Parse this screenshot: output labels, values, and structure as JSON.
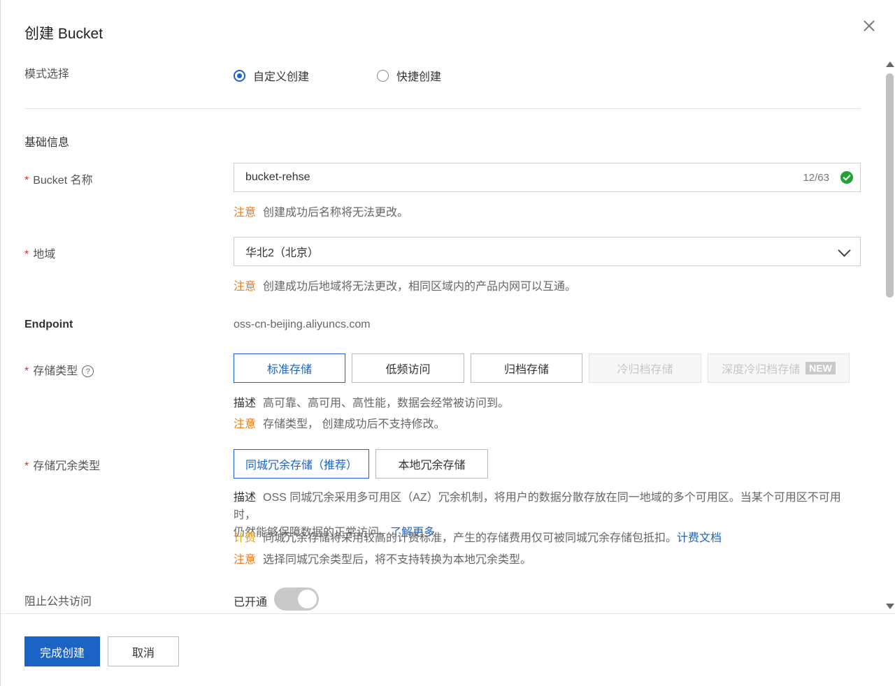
{
  "dialog": {
    "title": "创建 Bucket",
    "colors": {
      "accent": "#1b64c6",
      "warning": "#f07a14",
      "billing": "#e6a817",
      "required": "#d93026",
      "success": "#23a036"
    }
  },
  "mode": {
    "label": "模式选择",
    "options": [
      "自定义创建",
      "快捷创建"
    ],
    "selected": "自定义创建"
  },
  "basic_section": {
    "label": "基础信息"
  },
  "bucket_name": {
    "required_mark": "*",
    "label": "Bucket 名称",
    "value": "bucket-rehse",
    "counter": "12/63",
    "note_key": "注意",
    "note": "创建成功后名称将无法更改。"
  },
  "region": {
    "required_mark": "*",
    "label": "地域",
    "value": "华北2（北京）",
    "note_key": "注意",
    "note": "创建成功后地域将无法更改，相同区域内的产品内网可以互通。"
  },
  "endpoint": {
    "label": "Endpoint",
    "value": "oss-cn-beijing.aliyuncs.com"
  },
  "storage_class": {
    "required_mark": "*",
    "label": "存储类型",
    "help_icon": "?",
    "options": [
      "标准存储",
      "低频访问",
      "归档存储",
      "冷归档存储",
      "深度冷归档存储"
    ],
    "new_badge": "NEW",
    "selected": "标准存储",
    "desc_key": "描述",
    "desc": "高可靠、高可用、高性能，数据会经常被访问到。",
    "note_key": "注意",
    "note": "存储类型， 创建成功后不支持修改。"
  },
  "redundancy": {
    "required_mark": "*",
    "label": "存储冗余类型",
    "options": [
      "同城冗余存储（推荐）",
      "本地冗余存储"
    ],
    "selected": "同城冗余存储（推荐）",
    "desc_key": "描述",
    "desc_line1": "OSS 同城冗余采用多可用区（AZ）冗余机制，将用户的数据分散存放在同一地域的多个可用区。当某个可用区不可用时，",
    "desc_line2": "仍然能够保障数据的正常访问。",
    "learn_more": "了解更多",
    "billing_key": "计费",
    "billing": "同城冗余存储将采用较高的计费标准，产生的存储费用仅可被同城冗余存储包抵扣。",
    "billing_link": "计费文档",
    "note_key": "注意",
    "note": "选择同城冗余类型后，将不支持转换为本地冗余类型。"
  },
  "block_public": {
    "label": "阻止公共访问",
    "status": "已开通",
    "enabled": true
  },
  "footer": {
    "confirm": "完成创建",
    "cancel": "取消"
  }
}
